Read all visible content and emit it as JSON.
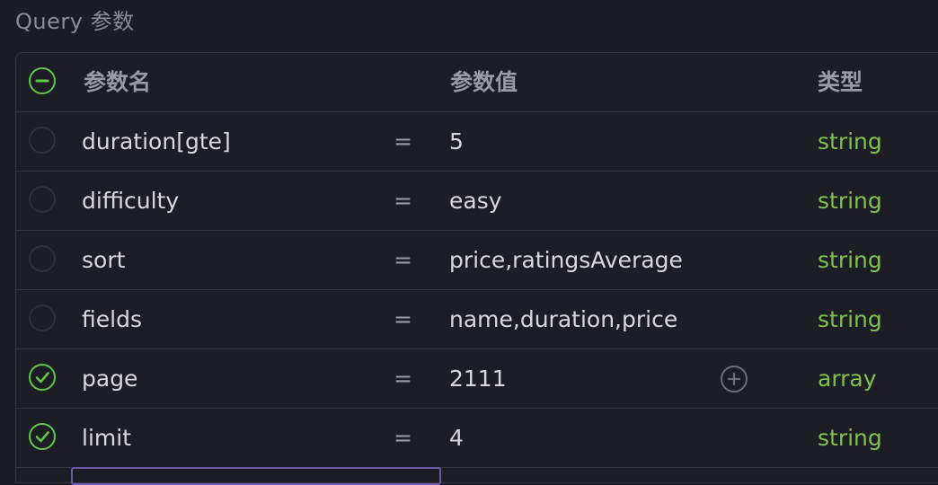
{
  "section_title": "Query 参数",
  "header": {
    "name": "参数名",
    "value": "参数值",
    "type": "类型"
  },
  "equals_sign": "=",
  "rows": [
    {
      "name": "duration[gte]",
      "value": "5",
      "type": "string",
      "checked": false
    },
    {
      "name": "difficulty",
      "value": "easy",
      "type": "string",
      "checked": false
    },
    {
      "name": "sort",
      "value": "price,ratingsAverage",
      "type": "string",
      "checked": false
    },
    {
      "name": "fields",
      "value": "name,duration,price",
      "type": "string",
      "checked": false
    },
    {
      "name": "page",
      "value": "2111",
      "type": "array",
      "checked": true
    },
    {
      "name": "limit",
      "value": "4",
      "type": "string",
      "checked": true
    }
  ],
  "icons": {
    "select_all": "minus-circle-icon",
    "checked": "check-circle-icon",
    "add_value": "plus-circle-icon"
  },
  "colors": {
    "background": "#1c1c24",
    "accent_green": "#63c64a",
    "type_text": "#7fc150",
    "input_focus": "#6b59a8"
  }
}
